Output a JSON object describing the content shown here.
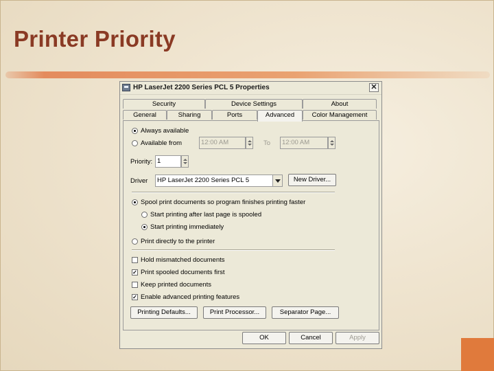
{
  "slide": {
    "title": "Printer Priority"
  },
  "dialog": {
    "title": "HP LaserJet 2200 Series PCL 5 Properties",
    "close_glyph": "✕",
    "tabs_back": [
      "Security",
      "Device Settings",
      "About"
    ],
    "tabs_front": [
      "General",
      "Sharing",
      "Ports",
      "Advanced",
      "Color Management"
    ],
    "active_tab": "Advanced",
    "always_available": "Always available",
    "available_from": "Available from",
    "from_time": "12:00 AM",
    "to_label": "To",
    "to_time": "12:00 AM",
    "priority_label": "Priority:",
    "priority_value": "1",
    "driver_label": "Driver",
    "driver_value": "HP LaserJet 2200 Series PCL 5",
    "new_driver": "New Driver...",
    "spool": "Spool print documents so program finishes printing faster",
    "start_after_last": "Start printing after last page is spooled",
    "start_immediately": "Start printing immediately",
    "print_directly": "Print directly to the printer",
    "hold_mismatched": "Hold mismatched documents",
    "print_spooled_first": "Print spooled documents first",
    "keep_printed": "Keep printed documents",
    "enable_advanced": "Enable advanced printing features",
    "check_mark": "✓",
    "printing_defaults": "Printing Defaults...",
    "print_processor": "Print Processor...",
    "separator_page": "Separator Page...",
    "ok": "OK",
    "cancel": "Cancel",
    "apply": "Apply",
    "checkbox_states": {
      "hold_mismatched": false,
      "print_spooled_first": true,
      "keep_printed": false,
      "enable_advanced": true
    }
  }
}
